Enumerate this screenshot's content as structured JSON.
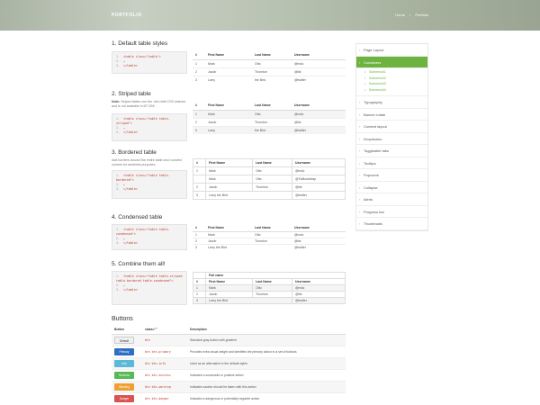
{
  "header": {
    "brand": "PORTFOLIO",
    "crumb_home": "Home",
    "crumb_sep": "/",
    "crumb_current": "Portfolio"
  },
  "sections": {
    "default": {
      "title": "1. Default table styles",
      "code": [
        "<table class=\"table\">",
        "…",
        "</table>"
      ]
    },
    "striped": {
      "title": "2. Striped table",
      "note_label": "Note:",
      "note_text": "Striped tables use the :nth-child CSS selector and is not available in IE7-IE8.",
      "code": [
        "<table class=\"table table-striped\">",
        "…",
        "</table>"
      ]
    },
    "bordered": {
      "title": "3. Bordered table",
      "note_text": "Add borders around the entire table and rounded corners for aesthetic purposes.",
      "code": [
        "<table class=\"table table-bordered\">",
        "…",
        "</table>"
      ]
    },
    "condensed": {
      "title": "4. Condensed table",
      "code": [
        "<table class=\"table table-condensed\">",
        "…",
        "</table>"
      ]
    },
    "combined": {
      "title": "5. Combine them all!",
      "code": [
        "<table class=\"table table-striped table-bordered table-condensed\">",
        "…",
        "</table>"
      ]
    }
  },
  "table_headers": {
    "num": "#",
    "first": "First Name",
    "last": "Last Name",
    "user": "Username",
    "full": "Full name"
  },
  "tables": {
    "default": [
      [
        "1",
        "Mark",
        "Otto",
        "@mdo"
      ],
      [
        "2",
        "Jacob",
        "Thornton",
        "@fat"
      ],
      [
        "3",
        "Larry",
        "the Bird",
        "@twitter"
      ]
    ],
    "striped": [
      [
        "1",
        "Mark",
        "Otto",
        "@mdo"
      ],
      [
        "2",
        "Jacob",
        "Thornton",
        "@fat"
      ],
      [
        "3",
        "Larry",
        "the Bird",
        "@twitter"
      ]
    ],
    "bordered": [
      [
        "1",
        "Mark",
        "Otto",
        "@mdo"
      ],
      [
        "",
        "Mark",
        "Otto",
        "@TwBootstrap"
      ],
      [
        "2",
        "Jacob",
        "Thornton",
        "@fat"
      ],
      [
        "3",
        "Larry the Bird",
        "",
        "@twitter"
      ]
    ],
    "condensed": [
      [
        "1",
        "Mark",
        "Otto",
        "@mdo"
      ],
      [
        "2",
        "Jacob",
        "Thornton",
        "@fat"
      ],
      [
        "3",
        "Larry the Bird",
        "",
        "@twitter"
      ]
    ],
    "combined": [
      [
        "1",
        "Mark",
        "Otto",
        "@mdo"
      ],
      [
        "2",
        "Jacob",
        "Thornton",
        "@fat"
      ],
      [
        "3",
        "Larry the Bird",
        "",
        "@twitter"
      ]
    ]
  },
  "buttons": {
    "title": "Buttons",
    "headers": {
      "button": "Button",
      "class": "class=\"\"",
      "desc": "Description"
    },
    "rows": [
      {
        "label": "Default",
        "cls": "btn",
        "desc": "Standard gray button with gradient"
      },
      {
        "label": "Primary",
        "cls": "btn btn-primary",
        "desc": "Provides extra visual weight and identifies the primary action in a set of buttons"
      },
      {
        "label": "Info",
        "cls": "btn btn-info",
        "desc": "Used as an alternative to the default styles"
      },
      {
        "label": "Success",
        "cls": "btn btn-success",
        "desc": "Indicates a successful or positive action"
      },
      {
        "label": "Warning",
        "cls": "btn btn-warning",
        "desc": "Indicates caution should be taken with this action"
      },
      {
        "label": "Danger",
        "cls": "btn btn-danger",
        "desc": "Indicates a dangerous or potentially negative action"
      }
    ]
  },
  "sidebar": {
    "items": [
      "Page Layout",
      "Containers",
      "Typography",
      "Banner rotate",
      "Content layout",
      "Dropdowns",
      "Toggleable tabs",
      "Tooltips",
      "Popovers",
      "Collapse",
      "Alerts",
      "Progress bar",
      "Thumbnails"
    ],
    "active": "Containers",
    "subitems": [
      "Submenu01",
      "Submenu02",
      "Submenu03",
      "Submenu04"
    ]
  },
  "colors": {
    "accent": "#6cb33f",
    "code_string": "#c0392b"
  }
}
